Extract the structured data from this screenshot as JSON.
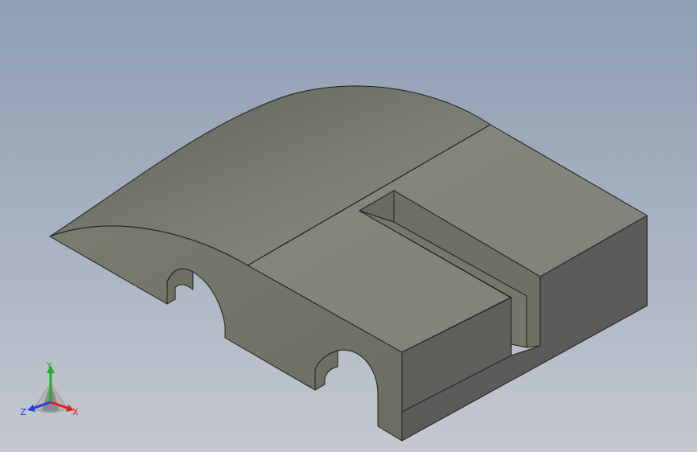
{
  "viewport": {
    "colors": {
      "background_top": "#8f9eb3",
      "background_bottom": "#c5c9d0",
      "face_top": "#84857c",
      "face_curved": "#7c7d73",
      "face_front": "#727366",
      "face_right": "#5b5b59",
      "edge": "#1e1e1e"
    }
  },
  "triad": {
    "x_label": "X",
    "y_label": "Y",
    "z_label": "Z",
    "colors": {
      "x": "#e02020",
      "y": "#20b020",
      "z": "#2040e0"
    }
  }
}
